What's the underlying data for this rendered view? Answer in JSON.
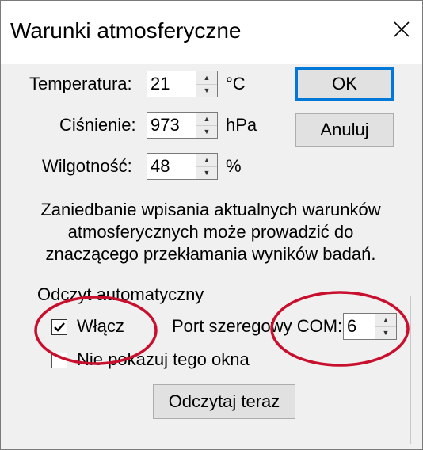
{
  "window": {
    "title": "Warunki atmosferyczne",
    "close_icon": "close-icon"
  },
  "fields": {
    "temperature": {
      "label": "Temperatura:",
      "value": "21",
      "unit": "°C"
    },
    "pressure": {
      "label": "Ciśnienie:",
      "value": "973",
      "unit": "hPa"
    },
    "humidity": {
      "label": "Wilgotność:",
      "value": "48",
      "unit": "%"
    }
  },
  "buttons": {
    "ok": "OK",
    "cancel": "Anuluj",
    "read_now": "Odczytaj teraz"
  },
  "note": "Zaniedbanie wpisania aktualnych warunków atmosferycznych może prowadzić do znaczącego przekłamania wyników badań.",
  "auto_read": {
    "group_title": "Odczyt automatyczny",
    "enable_label": "Włącz",
    "enable_checked": true,
    "port_label": "Port szeregowy COM:",
    "port_value": "6",
    "hide_window_label": "Nie pokazuj tego okna",
    "hide_window_checked": false
  },
  "colors": {
    "annotation_red": "#c8102e",
    "focus_blue": "#0078d7"
  }
}
